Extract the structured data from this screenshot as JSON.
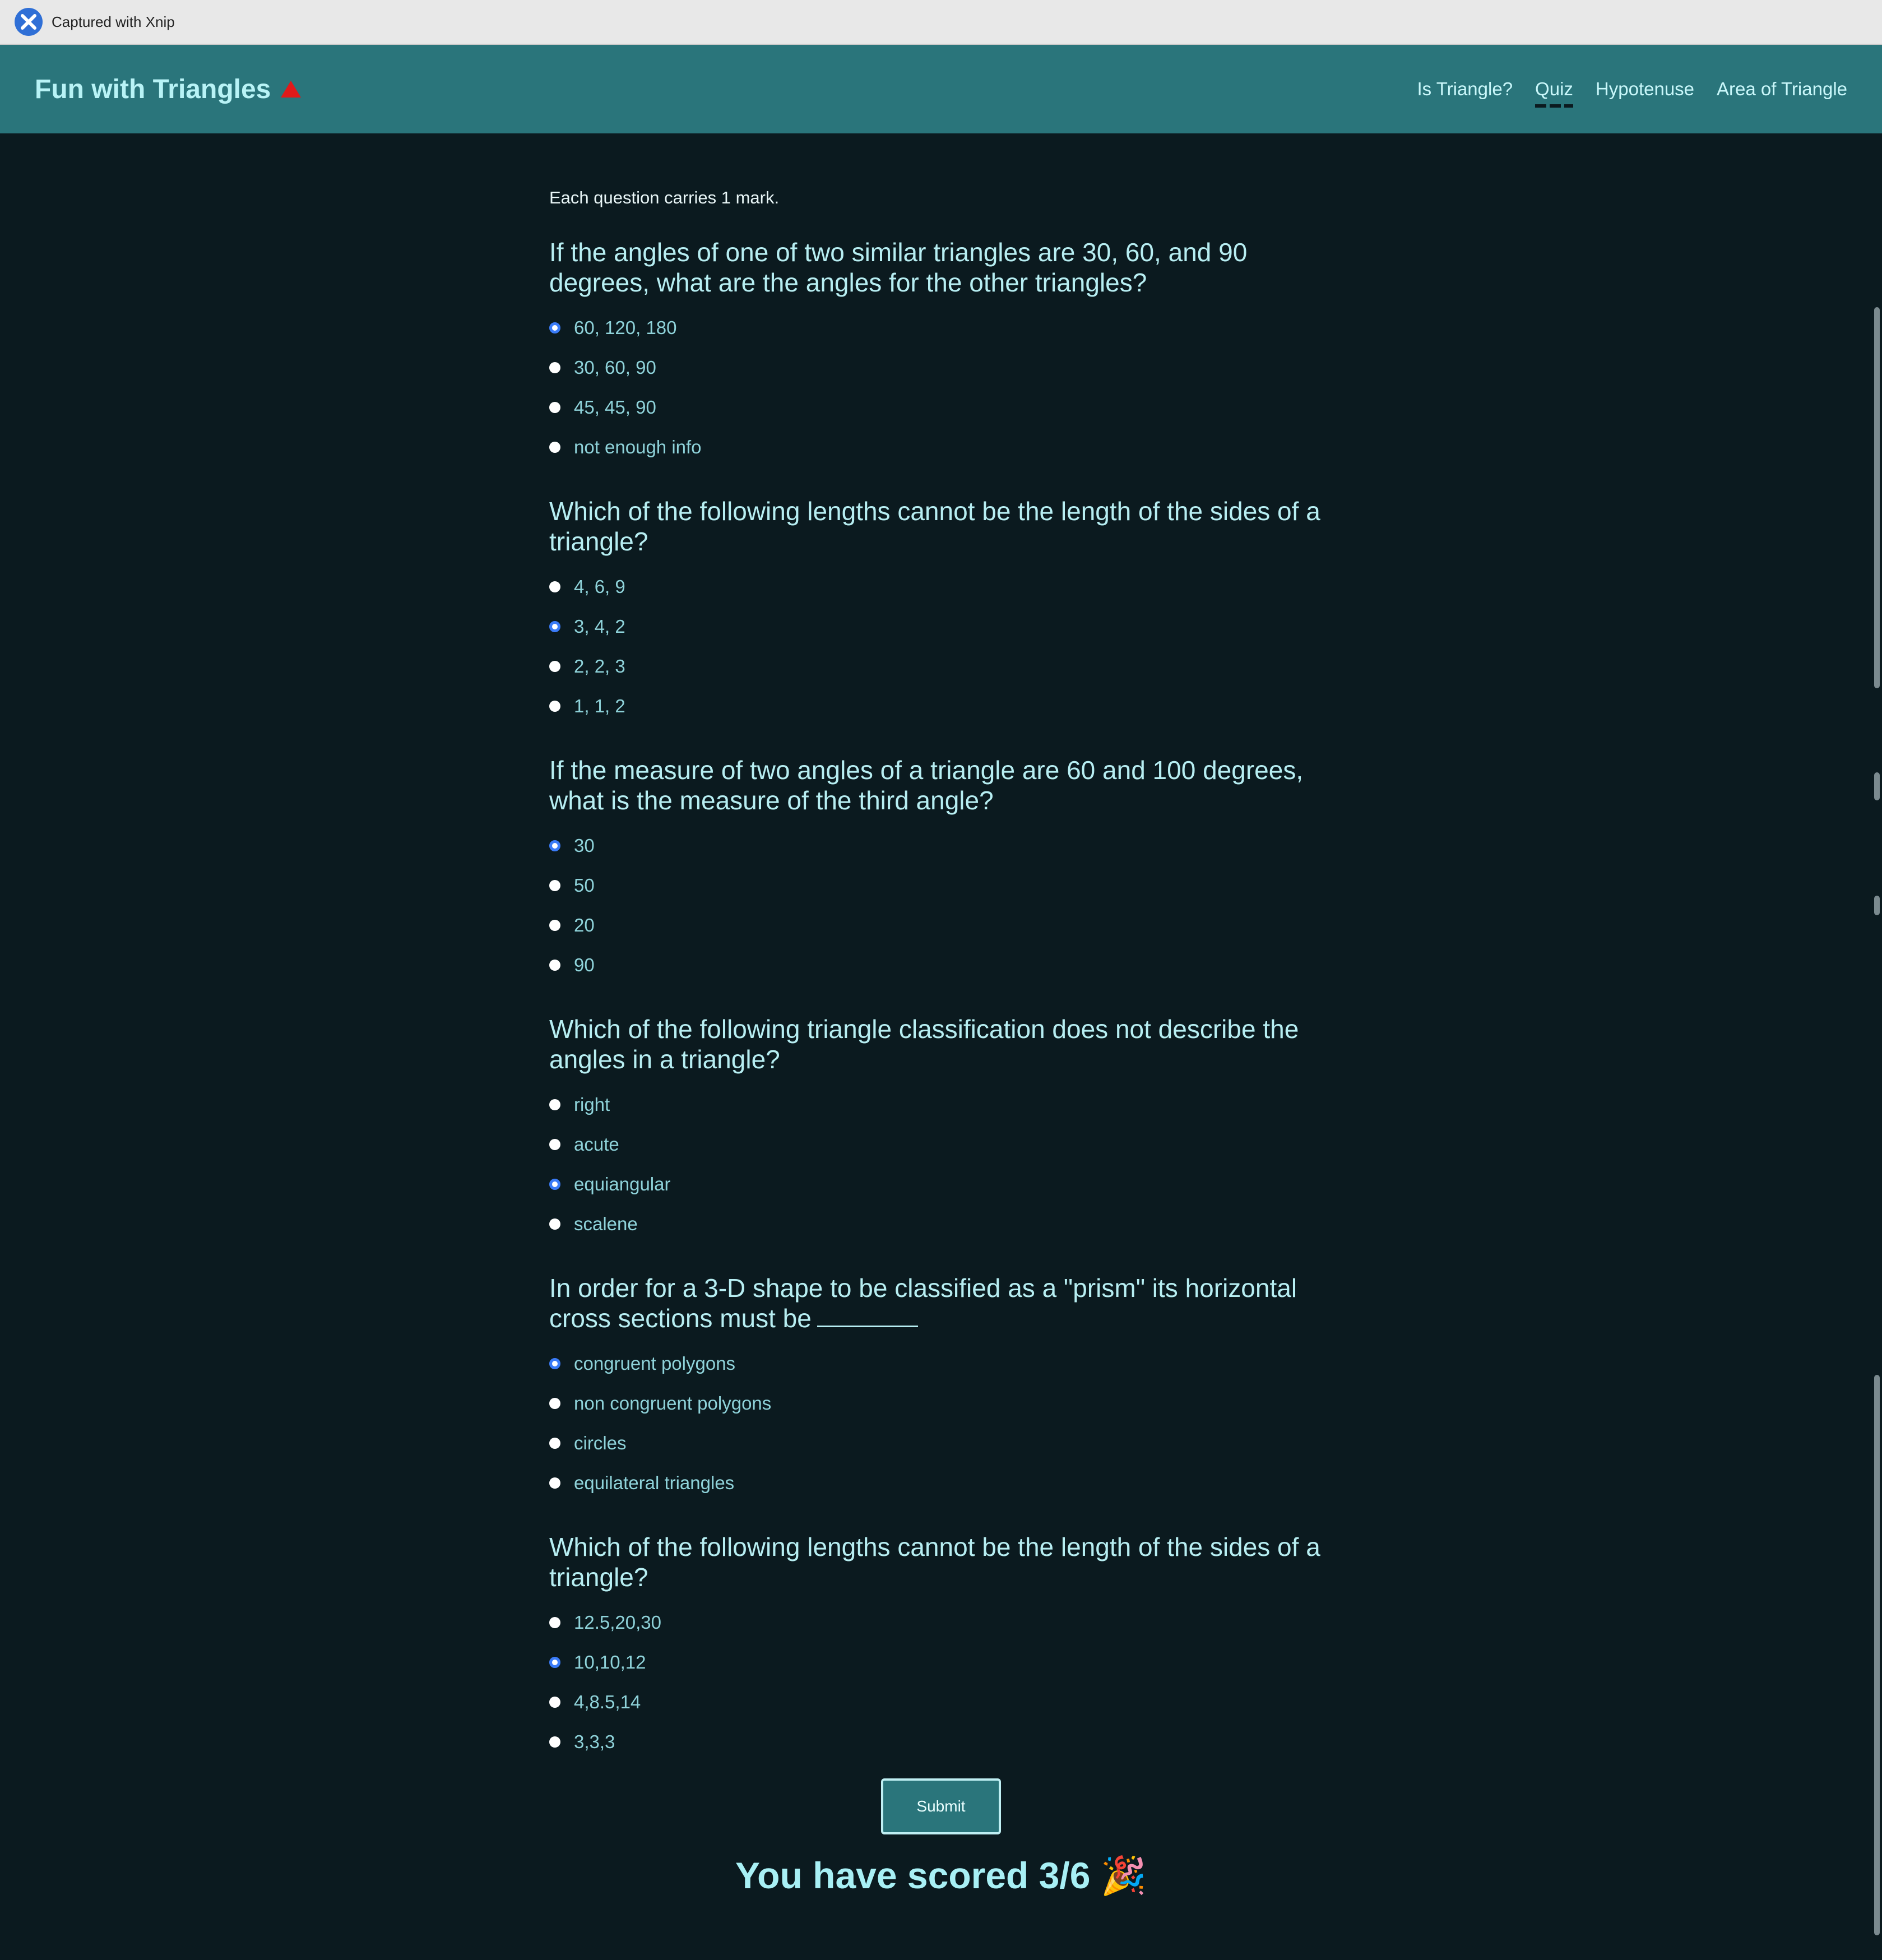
{
  "capture": {
    "label": "Captured with Xnip"
  },
  "header": {
    "brand": "Fun with Triangles",
    "nav": [
      "Is Triangle?",
      "Quiz",
      "Hypotenuse",
      "Area of Triangle"
    ],
    "active_nav": "Quiz"
  },
  "quiz": {
    "note": "Each question carries 1 mark.",
    "questions": [
      {
        "text": "If the angles of one of two similar triangles are 30, 60, and 90 degrees, what are the angles for the other triangles?",
        "options": [
          "60, 120, 180",
          "30, 60, 90",
          "45, 45, 90",
          "not enough info"
        ],
        "selected": 0
      },
      {
        "text": "Which of the following lengths cannot be the length of the sides of a triangle?",
        "options": [
          "4, 6, 9",
          "3, 4, 2",
          "2, 2, 3",
          "1, 1, 2"
        ],
        "selected": 1
      },
      {
        "text": "If the measure of two angles of a triangle are 60 and 100 degrees, what is the measure of the third angle?",
        "options": [
          "30",
          "50",
          "20",
          "90"
        ],
        "selected": 0
      },
      {
        "text": "Which of the following triangle classification does not describe the angles in a triangle?",
        "options": [
          "right",
          "acute",
          "equiangular",
          "scalene"
        ],
        "selected": 2
      },
      {
        "text": "In order for a 3-D shape to be classified as a \"prism\" its horizontal cross sections must be",
        "options": [
          "congruent polygons",
          "non congruent polygons",
          "circles",
          "equilateral triangles"
        ],
        "selected": 0
      },
      {
        "text": "Which of the following lengths cannot be the length of the sides of a triangle?",
        "options": [
          "12.5,20,30",
          "10,10,12",
          "4,8.5,14",
          "3,3,3"
        ],
        "selected": 1
      }
    ],
    "submit_label": "Submit",
    "score_text": "You have scored 3/6 🎉"
  },
  "colors": {
    "navbar": "#2a757b",
    "background": "#0b1a1f",
    "radio_selected": "#3a7bf7"
  }
}
